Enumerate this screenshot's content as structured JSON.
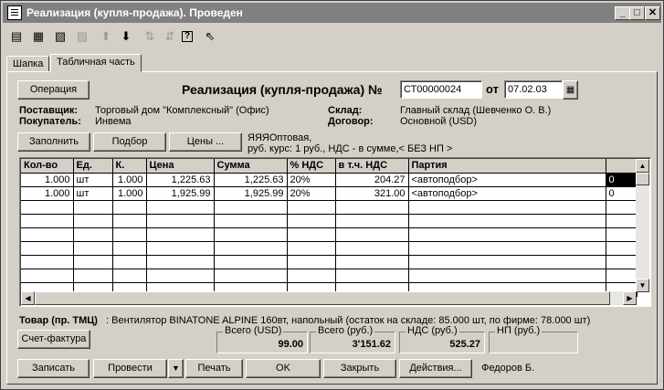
{
  "window": {
    "title": "Реализация (купля-продажа). Проведен"
  },
  "caption_buttons": {
    "minimize": "_",
    "maximize": "□",
    "close": "✕"
  },
  "toolbar": {
    "icons": [
      "new-row-icon",
      "add-row-icon",
      "copy-row-icon",
      "delete-row-icon",
      "move-up-icon",
      "move-down-icon",
      "sort-asc-icon",
      "sort-desc-icon",
      "help-icon",
      "context-help-icon"
    ]
  },
  "tabs": [
    {
      "label": "Шапка"
    },
    {
      "label": "Табличная часть"
    }
  ],
  "header": {
    "operation_button": "Операция",
    "doc_title": "Реализация (купля-продажа) №",
    "doc_number": "СТ00000024",
    "date_label": "от",
    "date_value": "07.02.03"
  },
  "info": {
    "supplier_label": "Поставщик:",
    "supplier_value": "Торговый дом \"Комплексный\" (Офис)",
    "buyer_label": "Покупатель:",
    "buyer_value": "Инвема",
    "warehouse_label": "Склад:",
    "warehouse_value": "Главный склад (Шевченко О. В.)",
    "contract_label": "Договор:",
    "contract_value": "Основной (USD)"
  },
  "actions": {
    "fill": "Заполнить",
    "select": "Подбор",
    "prices": "Цены ...",
    "price_info_line1": "ЯЯЯОптовая,",
    "price_info_line2": "руб. курс: 1 руб., НДС - в сумме,< БЕЗ НП >"
  },
  "table": {
    "headers": [
      "Кол-во",
      "Ед.",
      "К.",
      "Цена",
      "Сумма",
      "% НДС",
      "в т.ч. НДС",
      "Партия",
      ""
    ],
    "rows": [
      [
        "1.000",
        "шт",
        "1.000",
        "1,225.63",
        "1,225.63",
        "20%",
        "204.27",
        "<автоподбор>",
        "0"
      ],
      [
        "1.000",
        "шт",
        "1.000",
        "1,925.99",
        "1,925.99",
        "20%",
        "321.00",
        "<автоподбор>",
        "0"
      ]
    ]
  },
  "product": {
    "label": "Товар (пр. ТМЦ)",
    "text": ": Вентилятор BINATONE ALPINE 160вт, напольный (остаток на складе: 85.000 шт, по фирме: 78.000 шт)"
  },
  "invoice_button": "Счет-фактура",
  "totals": [
    {
      "label": "Всего (USD)",
      "value": "99.00"
    },
    {
      "label": "Всего (руб.)",
      "value": "3'151.62"
    },
    {
      "label": "НДС (руб.)",
      "value": "525.27"
    },
    {
      "label": "НП (руб.)",
      "value": ""
    }
  ],
  "footer": {
    "save": "Записать",
    "post": "Провести",
    "post_menu": "▼",
    "print": "Печать",
    "ok": "OK",
    "close": "Закрыть",
    "actions": "Действия...",
    "user": "Федоров Б."
  }
}
